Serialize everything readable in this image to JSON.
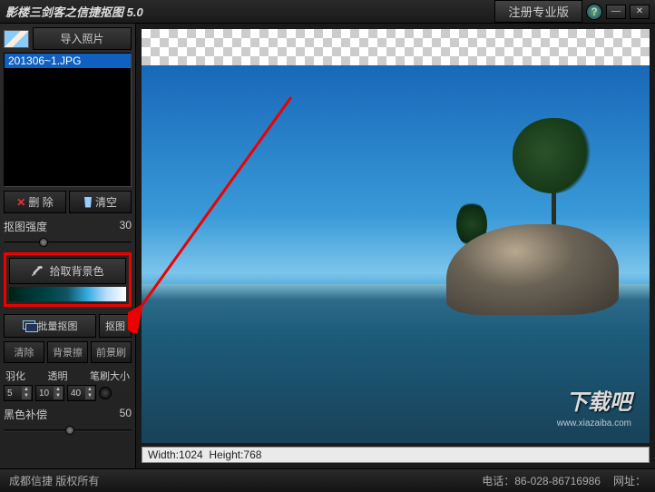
{
  "title": "影楼三剑客之信捷抠图 5.0",
  "titlebar": {
    "register": "注册专业版",
    "help": "?",
    "min": "—",
    "close": "✕"
  },
  "sidebar": {
    "import": "导入照片",
    "filelist": {
      "selected": "201306~1.JPG"
    },
    "delete": "删 除",
    "clear": "清空",
    "intensity_label": "抠图强度",
    "intensity_value": "30",
    "pick_bg": "拾取背景色",
    "batch": "批量抠图",
    "cut": "抠图",
    "tools": {
      "clear": "清除",
      "bg_erase": "背景擦",
      "fg_brush": "前景刷"
    },
    "feather": "羽化",
    "opacity": "透明",
    "brush": "笔刷大小",
    "feather_v": "5",
    "opacity_v": "10",
    "brush_v": "40",
    "black_comp": "黑色补偿",
    "black_v": "50"
  },
  "canvas": {
    "width_label": "Width:",
    "width_v": "1024",
    "height_label": "Height:",
    "height_v": "768"
  },
  "watermark": {
    "main": "下载吧",
    "sub": "www.xiazaiba.com"
  },
  "footer": {
    "left": "成都信捷 版权所有",
    "phone_lbl": "电话：",
    "phone": "86-028-86716986",
    "web_lbl": "网址："
  }
}
